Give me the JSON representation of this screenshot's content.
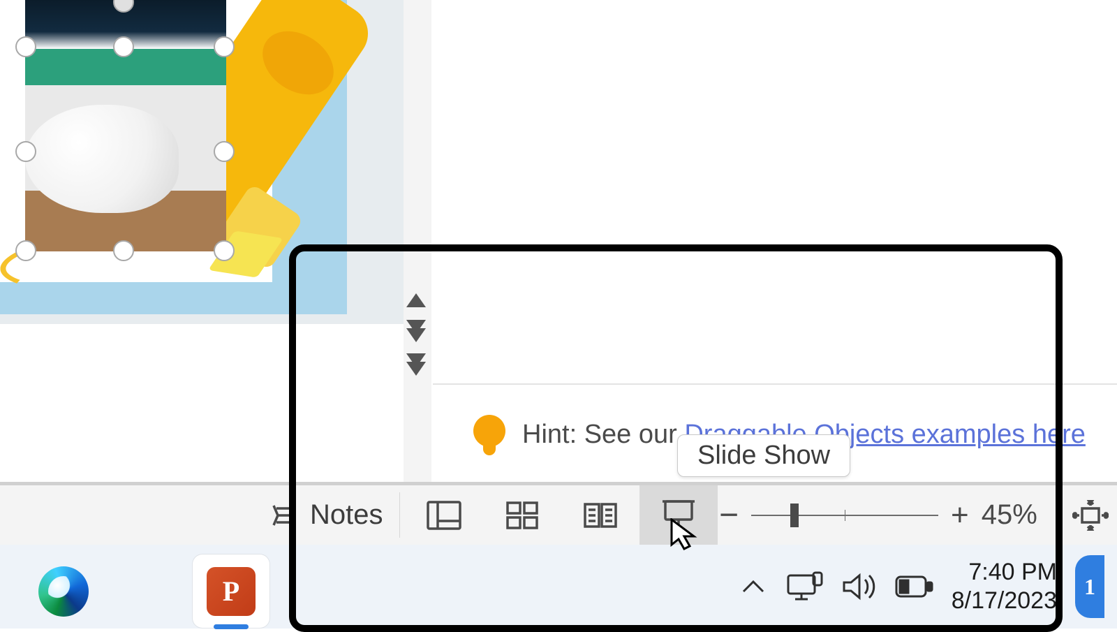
{
  "hint": {
    "prefix": "Hint: See our ",
    "link": "Draggable Objects examples here"
  },
  "tooltip": "Slide Show",
  "statusbar": {
    "notes_label": "Notes",
    "zoom_percent": "45%"
  },
  "taskbar": {
    "ppt_letter": "P",
    "time": "7:40 PM",
    "date": "8/17/2023",
    "notification_count": "1"
  }
}
